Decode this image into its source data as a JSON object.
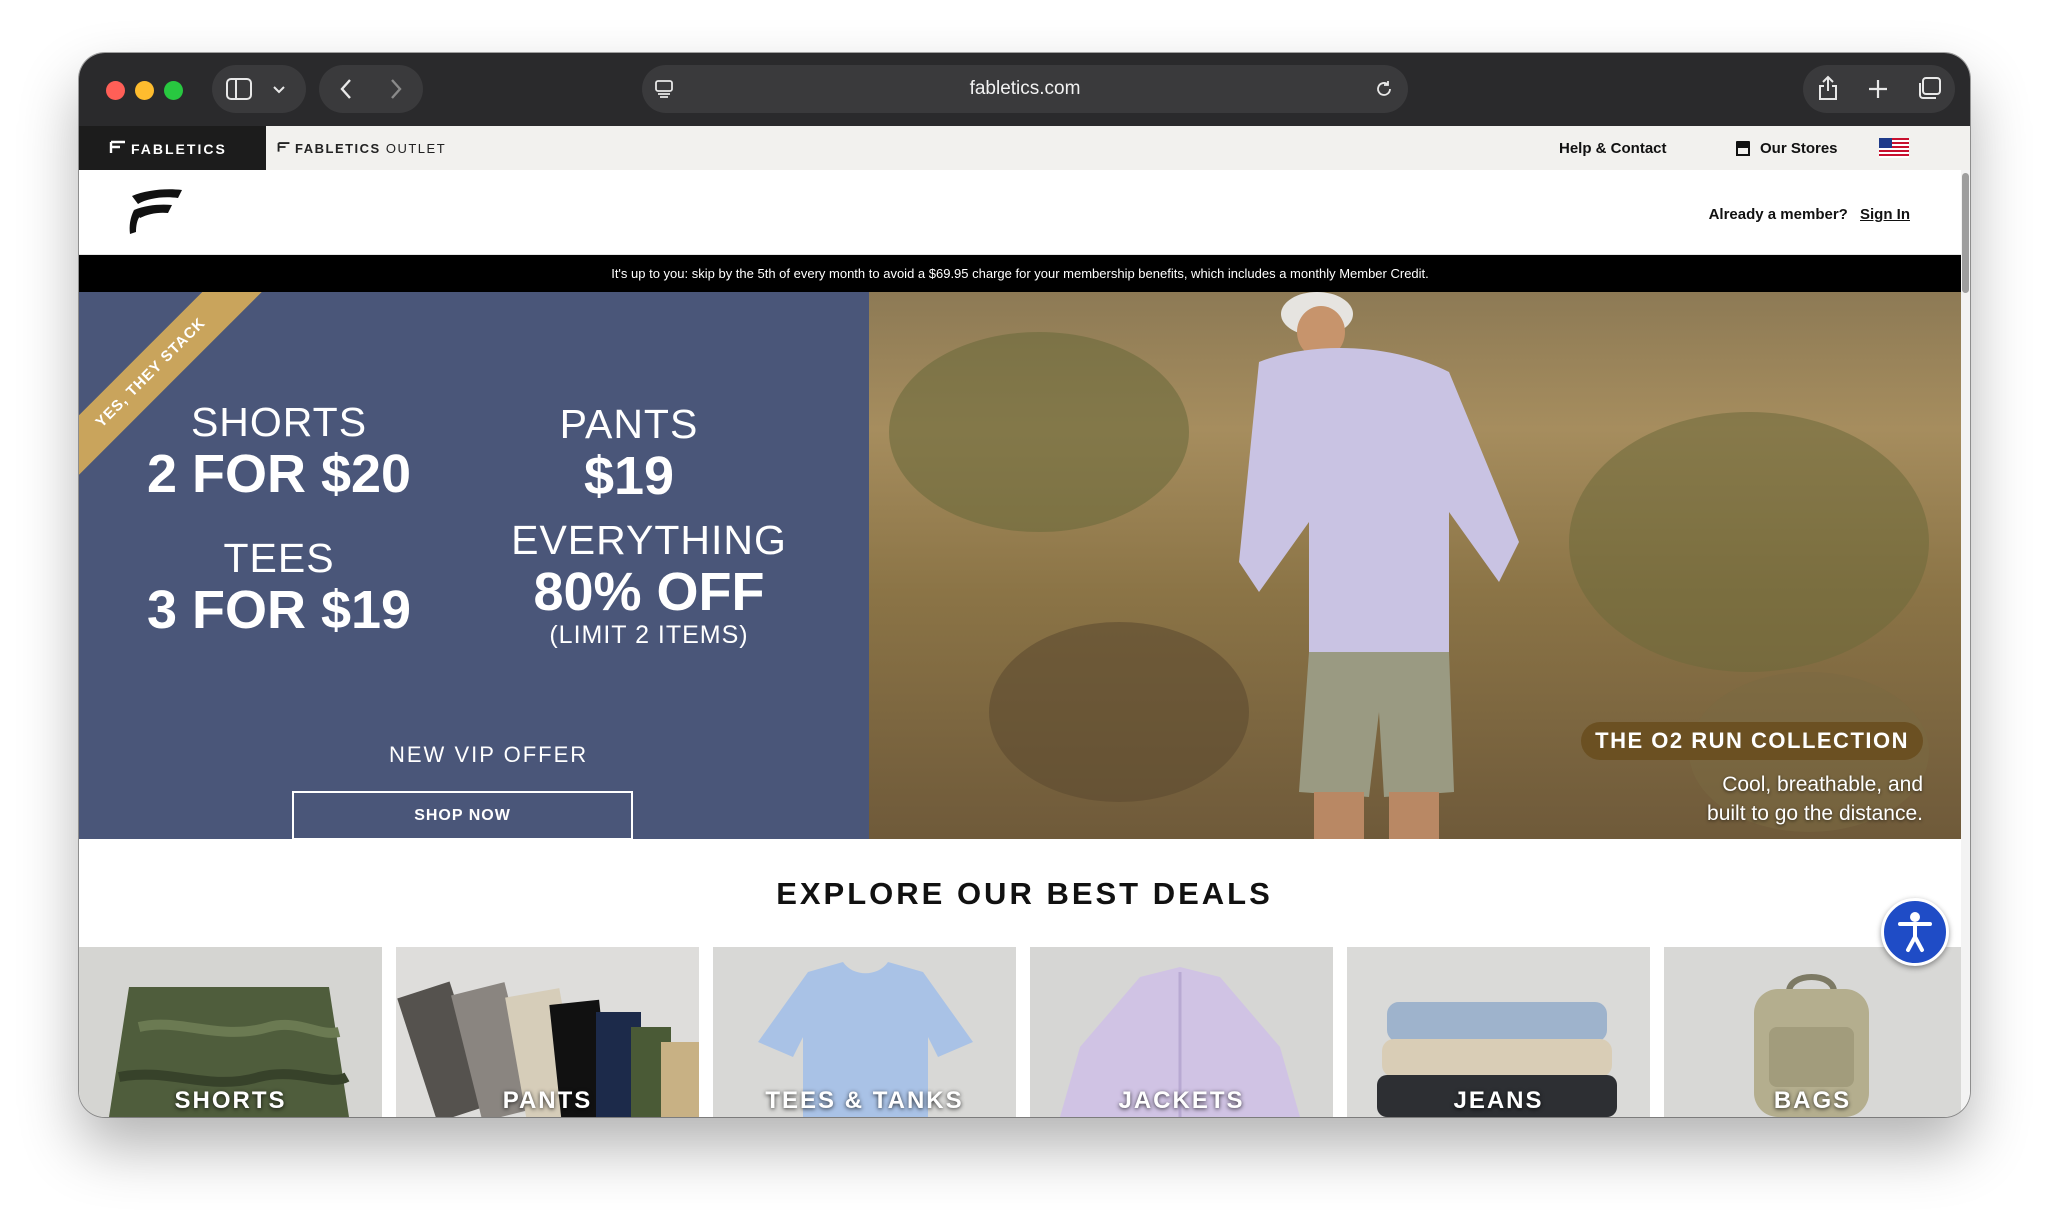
{
  "browser": {
    "url": "fabletics.com",
    "traffic_colors": [
      "#ff5f57",
      "#febc2e",
      "#28c840"
    ]
  },
  "sitebar": {
    "brand": "FABLETICS",
    "outlet_brand": "FABLETICS",
    "outlet_suffix": "OUTLET",
    "help": "Help & Contact",
    "stores": "Our Stores"
  },
  "header": {
    "member_prompt": "Already a member?",
    "sign_in": "Sign In"
  },
  "notice": "It's up to you: skip by the 5th of every month to avoid a $69.95 charge for your membership benefits, which includes a monthly Member Credit.",
  "hero": {
    "ribbon": "YES, THEY STACK",
    "shorts_label": "SHORTS",
    "shorts_deal": "2 FOR $20",
    "tees_label": "TEES",
    "tees_deal": "3 FOR $19",
    "pants_label": "PANTS",
    "pants_deal": "$19",
    "everything_label": "EVERYTHING",
    "everything_deal": "80% OFF",
    "everything_limit": "(LIMIT 2 ITEMS)",
    "vip": "NEW VIP OFFER",
    "cta": "SHOP NOW",
    "left_bg": "#4a5679",
    "ribbon_color": "#c9a45c"
  },
  "collection": {
    "title": "THE O2 RUN COLLECTION",
    "line1": "Cool, breathable, and",
    "line2": "built to go the distance."
  },
  "deals": {
    "title": "EXPLORE OUR BEST DEALS",
    "categories": [
      "SHORTS",
      "PANTS",
      "TEES & TANKS",
      "JACKETS",
      "JEANS",
      "BAGS"
    ]
  }
}
